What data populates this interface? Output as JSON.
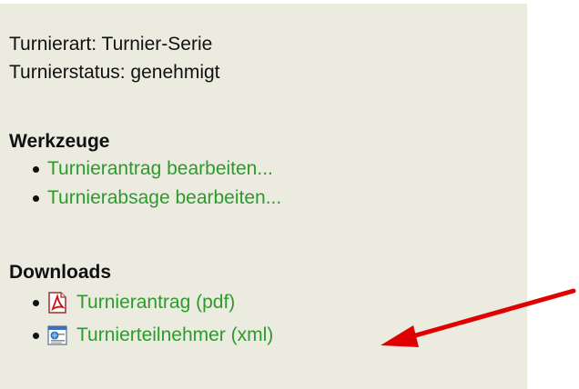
{
  "info": {
    "tournament_type": "Turnierart: Turnier-Serie",
    "tournament_status": "Turnierstatus: genehmigt"
  },
  "tools": {
    "title": "Werkzeuge",
    "items": [
      {
        "label": "Turnierantrag bearbeiten..."
      },
      {
        "label": "Turnierabsage bearbeiten..."
      }
    ]
  },
  "downloads": {
    "title": "Downloads",
    "items": [
      {
        "label": "Turnierantrag (pdf)",
        "icon": "pdf-file-icon"
      },
      {
        "label": "Turnierteilnehmer (xml)",
        "icon": "xml-file-icon"
      }
    ]
  },
  "annotation": {
    "icon": "red-arrow-icon",
    "color": "#e00000"
  },
  "colors": {
    "panel_background": "#ecebe0",
    "link": "#2e9a2e",
    "text": "#111111"
  }
}
